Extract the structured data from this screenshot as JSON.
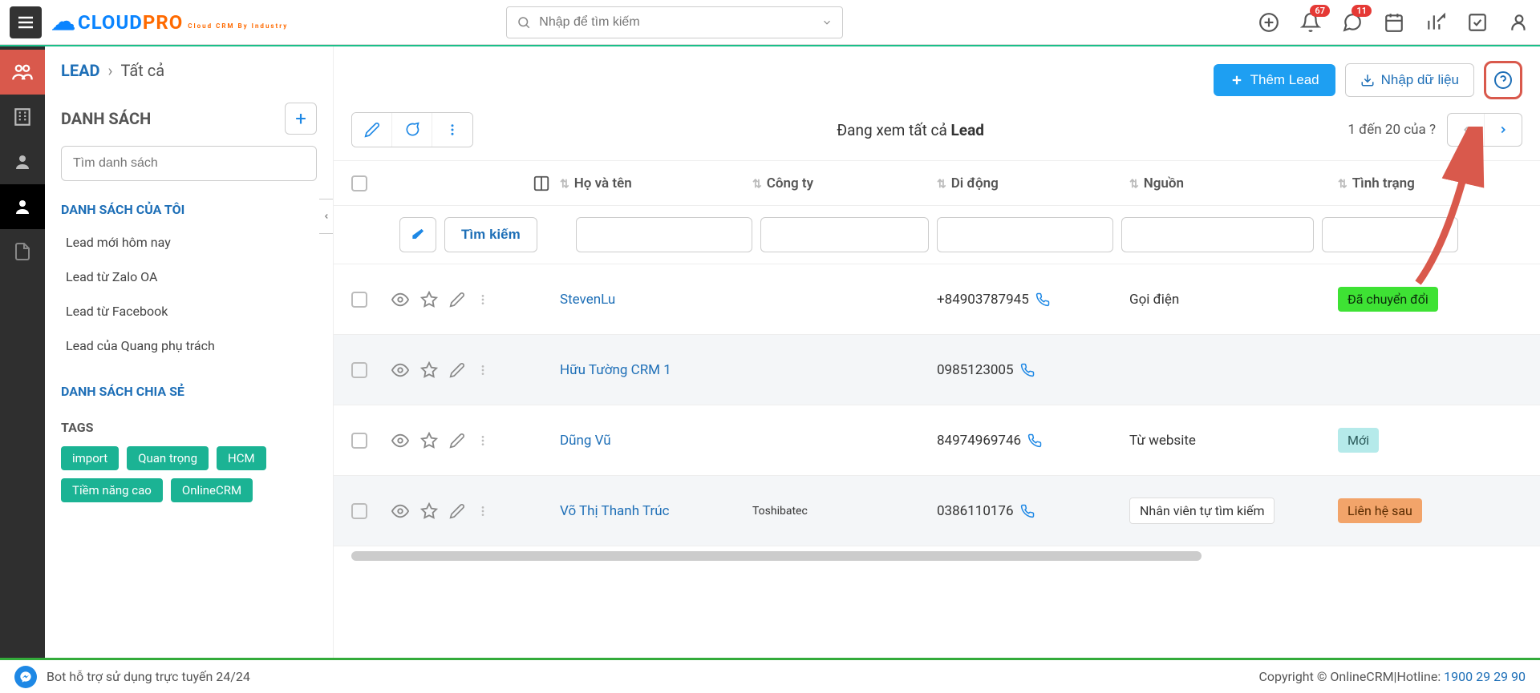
{
  "topbar": {
    "search_placeholder": "Nhập để tìm kiếm",
    "badges": {
      "bell": "67",
      "chat": "11"
    }
  },
  "logo": {
    "part1": "CLOUD",
    "part2": "PRO",
    "tagline": "Cloud CRM By Industry"
  },
  "breadcrumb": {
    "lead": "LEAD",
    "all": "Tất cả"
  },
  "sidebar": {
    "list_title": "DANH SÁCH",
    "search_placeholder": "Tìm danh sách",
    "my_lists_title": "DANH SÁCH CỦA TÔI",
    "my_lists": [
      "Lead mới hôm nay",
      "Lead từ Zalo OA",
      "Lead từ Facebook",
      "Lead của Quang phụ trách"
    ],
    "shared_title": "DANH SÁCH CHIA SẺ",
    "tags_title": "TAGS",
    "tags": [
      "import",
      "Quan trọng",
      "HCM",
      "Tiềm năng cao",
      "OnlineCRM"
    ]
  },
  "actions": {
    "add_lead": "Thêm Lead",
    "import": "Nhập dữ liệu"
  },
  "viewing": {
    "prefix": "Đang xem tất cả ",
    "entity": "Lead"
  },
  "pager": {
    "text": "1 đến 20 của ?"
  },
  "columns": {
    "name": "Họ và tên",
    "company": "Công ty",
    "mobile": "Di động",
    "source": "Nguồn",
    "status": "Tình trạng"
  },
  "filter": {
    "search_label": "Tìm kiếm"
  },
  "rows": [
    {
      "name": "StevenLu",
      "company": "",
      "mobile": "+84903787945",
      "source": "Gọi điện",
      "status": "Đã chuyển đổi",
      "status_class": "st-converted",
      "source_chip": false
    },
    {
      "name": "Hữu Tường CRM 1",
      "company": "",
      "mobile": "0985123005",
      "source": "",
      "status": "",
      "status_class": "",
      "source_chip": false
    },
    {
      "name": "Dũng Vũ",
      "company": "",
      "mobile": "84974969746",
      "source": "Từ website",
      "status": "Mới",
      "status_class": "st-new",
      "source_chip": false
    },
    {
      "name": "Võ Thị Thanh Trúc",
      "company": "Toshibatec",
      "mobile": "0386110176",
      "source": "Nhân viên tự tìm kiếm",
      "status": "Liên hệ sau",
      "status_class": "st-later",
      "source_chip": true
    }
  ],
  "footer": {
    "bot": "Bot hỗ trợ sử dụng trực tuyến 24/24",
    "copy_prefix": "Copyright © OnlineCRM|Hotline: ",
    "hotline": "1900 29 29 90"
  }
}
